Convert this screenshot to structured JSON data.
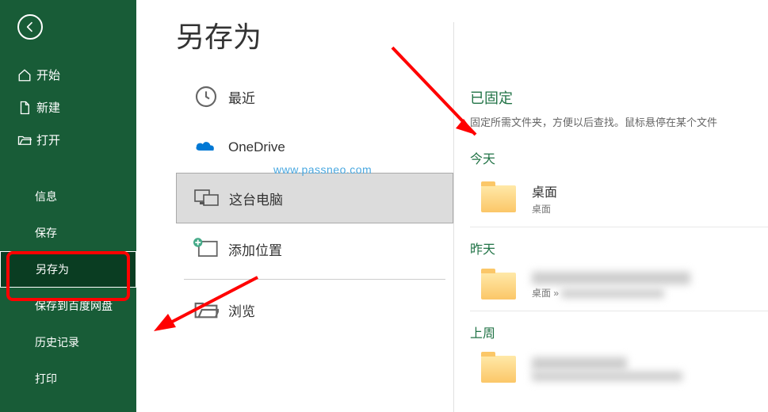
{
  "sidebar": {
    "items": [
      {
        "label": "开始"
      },
      {
        "label": "新建"
      },
      {
        "label": "打开"
      },
      {
        "label": "信息"
      },
      {
        "label": "保存"
      },
      {
        "label": "另存为"
      },
      {
        "label": "保存到百度网盘"
      },
      {
        "label": "历史记录"
      },
      {
        "label": "打印"
      }
    ]
  },
  "page": {
    "title": "另存为"
  },
  "locations": [
    {
      "label": "最近"
    },
    {
      "label": "OneDrive"
    },
    {
      "label": "这台电脑"
    },
    {
      "label": "添加位置"
    },
    {
      "label": "浏览"
    }
  ],
  "recent": {
    "pinned_head": "已固定",
    "pinned_sub": "固定所需文件夹，方便以后查找。鼠标悬停在某个文件",
    "groups": [
      {
        "label": "今天",
        "items": [
          {
            "name": "桌面",
            "path": "桌面"
          }
        ]
      },
      {
        "label": "昨天",
        "items": [
          {
            "name": "",
            "path": "桌面 »"
          }
        ]
      },
      {
        "label": "上周",
        "items": [
          {
            "name": "",
            "path": ""
          }
        ]
      }
    ]
  },
  "watermark": "www.passneo.com"
}
